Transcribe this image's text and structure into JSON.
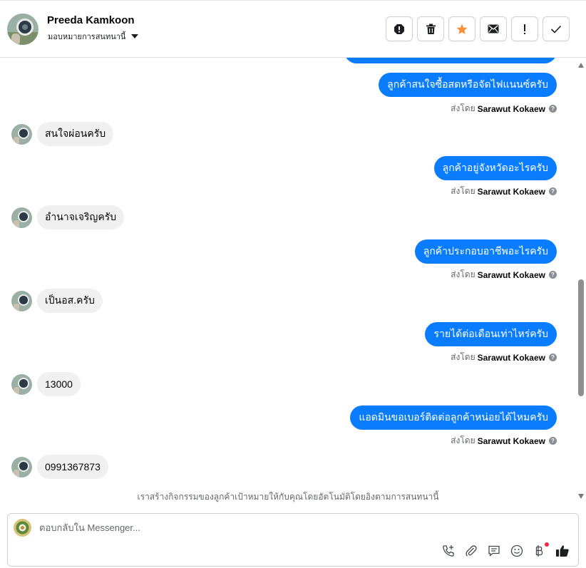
{
  "header": {
    "contact_name": "Preeda Kamkoon",
    "assign_label": "มอบหมายการสนทนานี้",
    "actions": [
      "spam-icon",
      "trash-icon",
      "star-icon",
      "envelope-icon",
      "exclamation-icon",
      "check-icon"
    ]
  },
  "colors": {
    "outgoing_bubble": "#0a7cff",
    "incoming_bubble": "#f0f0f0",
    "star": "#f7923a"
  },
  "messages": [
    {
      "dir": "out",
      "text": "ลูกค้าสนใจซื้อสดหรือจัดไฟแนนซ์ครับ",
      "sent_prefix": "ส่งโดย",
      "sender": "Sarawut Kokaew"
    },
    {
      "dir": "in",
      "text": "สนใจผ่อนครับ"
    },
    {
      "dir": "out",
      "text": "ลูกค้าอยู่จังหวัดอะไรครับ",
      "sent_prefix": "ส่งโดย",
      "sender": "Sarawut Kokaew"
    },
    {
      "dir": "in",
      "text": "อำนาจเจริญครับ"
    },
    {
      "dir": "out",
      "text": "ลูกค้าประกอบอาชีพอะไรครับ",
      "sent_prefix": "ส่งโดย",
      "sender": "Sarawut Kokaew"
    },
    {
      "dir": "in",
      "text": "เป็นอส.ครับ"
    },
    {
      "dir": "out",
      "text": "รายได้ต่อเดือนเท่าไหร่ครับ",
      "sent_prefix": "ส่งโดย",
      "sender": "Sarawut Kokaew"
    },
    {
      "dir": "in",
      "text": "13000"
    },
    {
      "dir": "out",
      "text": "แอดมินขอเบอร์ติดต่อลูกค้าหน่อยได้ไหมครับ",
      "sent_prefix": "ส่งโดย",
      "sender": "Sarawut Kokaew"
    },
    {
      "dir": "in",
      "text": "0991367873"
    }
  ],
  "notice": "เราสร้างกิจกรรมของลูกค้าเป้าหมายให้กับคุณโดยอัตโนมัติโดยอิงตามการสนทนานี้",
  "composer": {
    "placeholder": "ตอบกลับใน Messenger...",
    "tools": [
      "phone-plus-icon",
      "paperclip-icon",
      "saved-reply-icon",
      "emoji-icon",
      "baht-icon",
      "thumbs-up-icon"
    ]
  }
}
